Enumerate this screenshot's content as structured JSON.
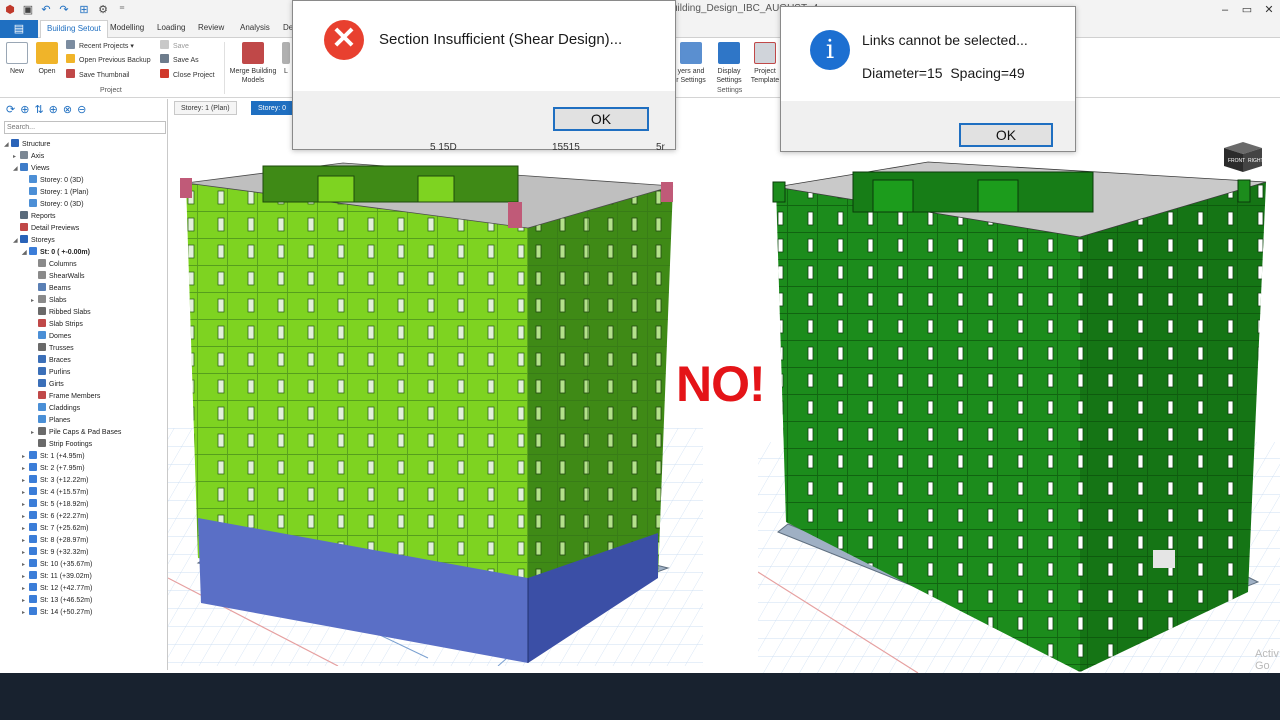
{
  "window": {
    "title": "uilding_Design_IBC_AUGUST_4",
    "controls": {
      "minimize": "–",
      "maximize": "▭",
      "close": "✕"
    }
  },
  "quick_access": {
    "extra": "⁼"
  },
  "ribbon": {
    "file_label": "▤",
    "tabs": [
      "Building Setout",
      "Modelling",
      "Loading",
      "Review",
      "Analysis",
      "De"
    ],
    "project_group": {
      "label": "Project",
      "new": "New",
      "open": "Open",
      "recent_projects": "Recent Projects",
      "open_previous_backup": "Open Previous Backup",
      "save_thumbnail": "Save Thumbnail",
      "save": "Save",
      "save_as": "Save As",
      "close_project": "Close Project",
      "merge_label": "Merge Building Models",
      "cut_label": "L"
    },
    "settings_group": {
      "label": "Settings",
      "layers": "yers and\nr Settings",
      "display": "Display\nSettings",
      "templates": "Project\nTemplate"
    }
  },
  "left_panel": {
    "search_placeholder": "Search...",
    "tree": [
      {
        "label": "Structure",
        "indent": 0,
        "exp": "◢",
        "icon": "structure-icon",
        "color": "#2a63b8"
      },
      {
        "label": "Axis",
        "indent": 1,
        "exp": "▸",
        "icon": "axis-icon",
        "color": "#7b8794"
      },
      {
        "label": "Views",
        "indent": 1,
        "exp": "◢",
        "icon": "views-icon",
        "color": "#3d7cc9"
      },
      {
        "label": "Storey: 0 (3D)",
        "indent": 2,
        "exp": "",
        "icon": "view-3d-icon",
        "color": "#4c8fd6"
      },
      {
        "label": "Storey: 1 (Plan)",
        "indent": 2,
        "exp": "",
        "icon": "view-plan-icon",
        "color": "#4c8fd6"
      },
      {
        "label": "Storey: 0 (3D)",
        "indent": 2,
        "exp": "",
        "icon": "view-3d-icon",
        "color": "#4c8fd6"
      },
      {
        "label": "Reports",
        "indent": 1,
        "exp": "",
        "icon": "reports-icon",
        "color": "#5a6b7c"
      },
      {
        "label": "Detail Previews",
        "indent": 1,
        "exp": "",
        "icon": "detail-previews-icon",
        "color": "#c04848"
      },
      {
        "label": "Storeys",
        "indent": 1,
        "exp": "◢",
        "icon": "storeys-icon",
        "color": "#2a63b8"
      },
      {
        "label": "St: 0 ( +-0.00m)",
        "indent": 2,
        "exp": "◢",
        "icon": "storey-dot-icon",
        "color": "#3b7dd8",
        "bold": true
      },
      {
        "label": "Columns",
        "indent": 3,
        "exp": "",
        "icon": "columns-icon",
        "color": "#8a8a8a"
      },
      {
        "label": "ShearWalls",
        "indent": 3,
        "exp": "",
        "icon": "shearwalls-icon",
        "color": "#8a8a8a"
      },
      {
        "label": "Beams",
        "indent": 3,
        "exp": "",
        "icon": "beams-icon",
        "color": "#5a7fb4"
      },
      {
        "label": "Slabs",
        "indent": 3,
        "exp": "▸",
        "icon": "slabs-icon",
        "color": "#8a8a8a"
      },
      {
        "label": "Ribbed Slabs",
        "indent": 3,
        "exp": "",
        "icon": "ribbed-slabs-icon",
        "color": "#6a6a6a"
      },
      {
        "label": "Slab Strips",
        "indent": 3,
        "exp": "",
        "icon": "slab-strips-icon",
        "color": "#c04848"
      },
      {
        "label": "Domes",
        "indent": 3,
        "exp": "",
        "icon": "domes-icon",
        "color": "#4a8fd6"
      },
      {
        "label": "Trusses",
        "indent": 3,
        "exp": "",
        "icon": "trusses-icon",
        "color": "#6a6a6a"
      },
      {
        "label": "Braces",
        "indent": 3,
        "exp": "",
        "icon": "braces-icon",
        "color": "#3b6fb8"
      },
      {
        "label": "Purlins",
        "indent": 3,
        "exp": "",
        "icon": "purlins-icon",
        "color": "#3b6fb8"
      },
      {
        "label": "Girts",
        "indent": 3,
        "exp": "",
        "icon": "girts-icon",
        "color": "#3b6fb8"
      },
      {
        "label": "Frame Members",
        "indent": 3,
        "exp": "",
        "icon": "frame-members-icon",
        "color": "#c04848"
      },
      {
        "label": "Claddings",
        "indent": 3,
        "exp": "",
        "icon": "claddings-icon",
        "color": "#4a8fd6"
      },
      {
        "label": "Planes",
        "indent": 3,
        "exp": "",
        "icon": "planes-icon",
        "color": "#4a8fd6"
      },
      {
        "label": "Pile Caps & Pad Bases",
        "indent": 3,
        "exp": "▸",
        "icon": "pile-caps-icon",
        "color": "#6a6a6a"
      },
      {
        "label": "Strip Footings",
        "indent": 3,
        "exp": "",
        "icon": "strip-footings-icon",
        "color": "#6a6a6a"
      },
      {
        "label": "St: 1 (+4.95m)",
        "indent": 2,
        "exp": "▸",
        "icon": "storey-dot-icon",
        "color": "#3b7dd8"
      },
      {
        "label": "St: 2 (+7.95m)",
        "indent": 2,
        "exp": "▸",
        "icon": "storey-dot-icon",
        "color": "#3b7dd8"
      },
      {
        "label": "St: 3 (+12.22m)",
        "indent": 2,
        "exp": "▸",
        "icon": "storey-dot-icon",
        "color": "#3b7dd8"
      },
      {
        "label": "St: 4 (+15.57m)",
        "indent": 2,
        "exp": "▸",
        "icon": "storey-dot-icon",
        "color": "#3b7dd8"
      },
      {
        "label": "St: 5 (+18.92m)",
        "indent": 2,
        "exp": "▸",
        "icon": "storey-dot-icon",
        "color": "#3b7dd8"
      },
      {
        "label": "St: 6 (+22.27m)",
        "indent": 2,
        "exp": "▸",
        "icon": "storey-dot-icon",
        "color": "#3b7dd8"
      },
      {
        "label": "St: 7 (+25.62m)",
        "indent": 2,
        "exp": "▸",
        "icon": "storey-dot-icon",
        "color": "#3b7dd8"
      },
      {
        "label": "St: 8 (+28.97m)",
        "indent": 2,
        "exp": "▸",
        "icon": "storey-dot-icon",
        "color": "#3b7dd8"
      },
      {
        "label": "St: 9 (+32.32m)",
        "indent": 2,
        "exp": "▸",
        "icon": "storey-dot-icon",
        "color": "#3b7dd8"
      },
      {
        "label": "St: 10 (+35.67m)",
        "indent": 2,
        "exp": "▸",
        "icon": "storey-dot-icon",
        "color": "#3b7dd8"
      },
      {
        "label": "St: 11 (+39.02m)",
        "indent": 2,
        "exp": "▸",
        "icon": "storey-dot-icon",
        "color": "#3b7dd8"
      },
      {
        "label": "St: 12 (+42.77m)",
        "indent": 2,
        "exp": "▸",
        "icon": "storey-dot-icon",
        "color": "#3b7dd8"
      },
      {
        "label": "St: 13 (+46.52m)",
        "indent": 2,
        "exp": "▸",
        "icon": "storey-dot-icon",
        "color": "#3b7dd8"
      },
      {
        "label": "St: 14 (+50.27m)",
        "indent": 2,
        "exp": "▸",
        "icon": "storey-dot-icon",
        "color": "#3b7dd8"
      }
    ]
  },
  "view_tabs": [
    "Storey: 1 (Plan)",
    "Storey: 0"
  ],
  "overlay_text": "NO!",
  "dialog_error": {
    "message": "Section Insufficient (Shear Design)...",
    "ok": "OK",
    "icon_glyph": "✕"
  },
  "dialog_info": {
    "message": "Links cannot be selected...",
    "detail": "Diameter=15  Spacing=49",
    "ok": "OK",
    "icon_glyph": "i"
  },
  "behind_dialog_text": {
    "left": "5  15D",
    "mid": "15515",
    "right": "5r"
  },
  "navcube": {
    "front": "FRONT",
    "right": "RIGHT"
  },
  "watermark": "Activ\nGo to",
  "colors": {
    "accent": "#1f6fc1",
    "building_left": "#7ed321",
    "building_left_shadow": "#3f8a16",
    "building_right": "#1c8c1c",
    "base_storey": "#5a6fc6",
    "error_red": "#e8402f",
    "no_red": "#e41418",
    "taskbar": "#18222f"
  }
}
